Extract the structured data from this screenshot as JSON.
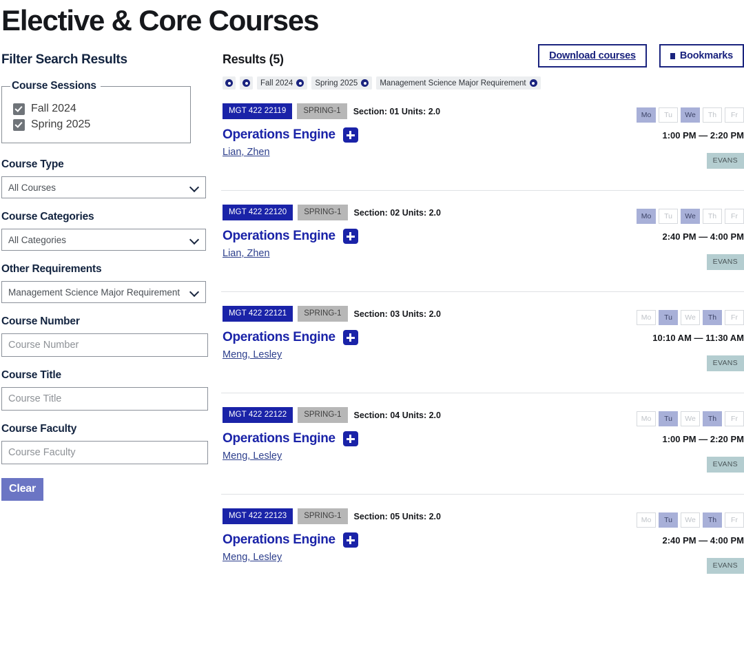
{
  "page_title": "Elective & Core Courses",
  "colors": {
    "brand_blue": "#1a23a8",
    "navy": "#1a237e",
    "clear_button": "#6b75c4",
    "day_active": "#a8b0d8",
    "location_badge": "#b4cdd0",
    "term_badge": "#b7b7b7"
  },
  "sidebar": {
    "heading": "Filter Search Results",
    "sessions": {
      "legend": "Course Sessions",
      "options": [
        {
          "label": "Fall 2024",
          "checked": true
        },
        {
          "label": "Spring 2025",
          "checked": true
        }
      ]
    },
    "course_type": {
      "label": "Course Type",
      "value": "All Courses"
    },
    "course_categories": {
      "label": "Course Categories",
      "value": "All Categories"
    },
    "other_requirements": {
      "label": "Other Requirements",
      "value": "Management Science Major Requirement"
    },
    "course_number": {
      "label": "Course Number",
      "value": "",
      "placeholder": "Course Number"
    },
    "course_title": {
      "label": "Course Title",
      "value": "",
      "placeholder": "Course Title"
    },
    "course_faculty": {
      "label": "Course Faculty",
      "value": "",
      "placeholder": "Course Faculty"
    },
    "clear_button": "Clear"
  },
  "results": {
    "heading": "Results (5)",
    "download_button": "Download courses",
    "bookmarks_button": "Bookmarks",
    "chips": [
      {
        "label": "",
        "icon_only": true
      },
      {
        "label": "",
        "icon_only": true
      },
      {
        "label": "Fall 2024",
        "icon_only": false
      },
      {
        "label": "Spring 2025",
        "icon_only": false
      },
      {
        "label": "Management Science Major Requirement",
        "icon_only": false
      }
    ],
    "day_labels": [
      "Mo",
      "Tu",
      "We",
      "Th",
      "Fr"
    ],
    "rows": [
      {
        "code": "MGT 422 22119",
        "term": "SPRING-1",
        "section_units": "Section: 01  Units: 2.0",
        "title": "Operations Engine",
        "faculty": "Lian, Zhen",
        "days": [
          true,
          false,
          true,
          false,
          false
        ],
        "time": "1:00 PM — 2:20 PM",
        "location": "EVANS"
      },
      {
        "code": "MGT 422 22120",
        "term": "SPRING-1",
        "section_units": "Section: 02  Units: 2.0",
        "title": "Operations Engine",
        "faculty": "Lian, Zhen",
        "days": [
          true,
          false,
          true,
          false,
          false
        ],
        "time": "2:40 PM — 4:00 PM",
        "location": "EVANS"
      },
      {
        "code": "MGT 422 22121",
        "term": "SPRING-1",
        "section_units": "Section: 03  Units: 2.0",
        "title": "Operations Engine",
        "faculty": "Meng, Lesley",
        "days": [
          false,
          true,
          false,
          true,
          false
        ],
        "time": "10:10 AM — 11:30 AM",
        "location": "EVANS"
      },
      {
        "code": "MGT 422 22122",
        "term": "SPRING-1",
        "section_units": "Section: 04  Units: 2.0",
        "title": "Operations Engine",
        "faculty": "Meng, Lesley",
        "days": [
          false,
          true,
          false,
          true,
          false
        ],
        "time": "1:00 PM — 2:20 PM",
        "location": "EVANS"
      },
      {
        "code": "MGT 422 22123",
        "term": "SPRING-1",
        "section_units": "Section: 05  Units: 2.0",
        "title": "Operations Engine",
        "faculty": "Meng, Lesley",
        "days": [
          false,
          true,
          false,
          true,
          false
        ],
        "time": "2:40 PM — 4:00 PM",
        "location": "EVANS"
      }
    ]
  }
}
